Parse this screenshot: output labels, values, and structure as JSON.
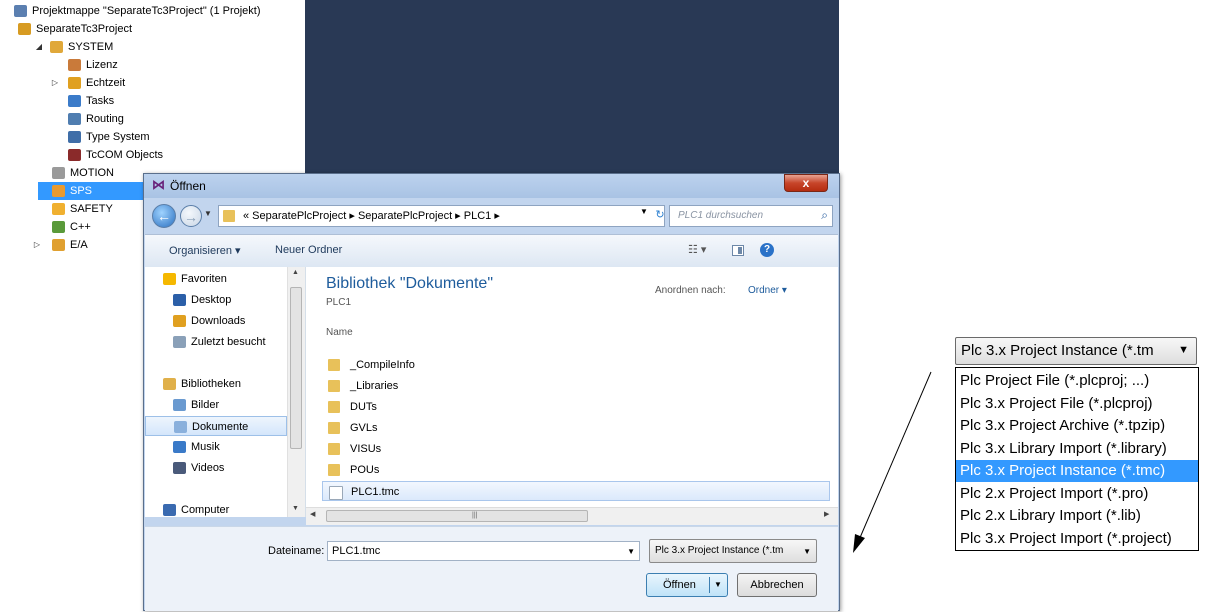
{
  "solution_tree": {
    "items": [
      {
        "label": "Projektmappe \"SeparateTc3Project\" (1 Projekt)",
        "icon": "solution-icon",
        "expander": "",
        "color": "#5b7fb0"
      },
      {
        "label": "SeparateTc3Project",
        "icon": "project-icon",
        "expander": "◢",
        "color": "#d79b22"
      },
      {
        "label": "SYSTEM",
        "icon": "system-icon",
        "expander": "◢",
        "color": "#e0a83a"
      },
      {
        "label": "Lizenz",
        "icon": "license-icon",
        "expander": "",
        "color": "#c97a3a"
      },
      {
        "label": "Echtzeit",
        "icon": "realtime-icon",
        "expander": "▷",
        "color": "#e0a020"
      },
      {
        "label": "Tasks",
        "icon": "tasks-icon",
        "expander": "",
        "color": "#3b7bc9"
      },
      {
        "label": "Routing",
        "icon": "routing-icon",
        "expander": "",
        "color": "#4f7db0"
      },
      {
        "label": "Type System",
        "icon": "type-system-icon",
        "expander": "",
        "color": "#3f6ea8"
      },
      {
        "label": "TcCOM Objects",
        "icon": "tccom-icon",
        "expander": "",
        "color": "#8a2a2a"
      },
      {
        "label": "MOTION",
        "icon": "motion-icon",
        "expander": "",
        "color": "#9a9a9a"
      },
      {
        "label": "SPS",
        "icon": "plc-icon",
        "expander": "",
        "color": "#e89a30"
      },
      {
        "label": "SAFETY",
        "icon": "safety-icon",
        "expander": "",
        "color": "#f0b030"
      },
      {
        "label": "C++",
        "icon": "cpp-icon",
        "expander": "",
        "color": "#5a9a3a"
      },
      {
        "label": "E/A",
        "icon": "io-icon",
        "expander": "▷",
        "color": "#e0a030"
      }
    ]
  },
  "dialog": {
    "title": "Öffnen",
    "close": "x",
    "address_path": "« SeparatePlcProject ▸ SeparatePlcProject ▸ PLC1 ▸",
    "search_placeholder": "PLC1 durchsuchen",
    "toolbar": {
      "organize": "Organisieren ▾",
      "new_folder": "Neuer Ordner",
      "views": "☷ ▾",
      "help": "?"
    },
    "nav": [
      {
        "label": "Favoriten",
        "icon": "star-icon",
        "indent": 0,
        "color": "#f5b800"
      },
      {
        "label": "Desktop",
        "icon": "desktop-icon",
        "indent": 1,
        "color": "#2b5fa8"
      },
      {
        "label": "Downloads",
        "icon": "downloads-icon",
        "indent": 1,
        "color": "#e0a020"
      },
      {
        "label": "Zuletzt besucht",
        "icon": "recent-icon",
        "indent": 1,
        "color": "#8aa0b8"
      },
      {
        "label": "",
        "icon": "",
        "indent": 0,
        "color": ""
      },
      {
        "label": "Bibliotheken",
        "icon": "library-icon",
        "indent": 0,
        "color": "#e0b04a"
      },
      {
        "label": "Bilder",
        "icon": "pictures-icon",
        "indent": 1,
        "color": "#6a9ad0"
      },
      {
        "label": "Dokumente",
        "icon": "documents-icon",
        "indent": 1,
        "color": "#8ab0dc"
      },
      {
        "label": "Musik",
        "icon": "music-icon",
        "indent": 1,
        "color": "#3a7ac8"
      },
      {
        "label": "Videos",
        "icon": "videos-icon",
        "indent": 1,
        "color": "#4a5a7a"
      },
      {
        "label": "",
        "icon": "",
        "indent": 0,
        "color": ""
      },
      {
        "label": "Computer",
        "icon": "computer-icon",
        "indent": 0,
        "color": "#3a6ab0"
      }
    ],
    "library_title": "Bibliothek \"Dokumente\"",
    "library_sub": "PLC1",
    "arrange_label": "Anordnen nach:",
    "arrange_value": "Ordner ▾",
    "column_name": "Name",
    "files": [
      {
        "name": "_CompileInfo",
        "type": "folder"
      },
      {
        "name": "_Libraries",
        "type": "folder"
      },
      {
        "name": "DUTs",
        "type": "folder"
      },
      {
        "name": "GVLs",
        "type": "folder"
      },
      {
        "name": "VISUs",
        "type": "folder"
      },
      {
        "name": "POUs",
        "type": "folder"
      },
      {
        "name": "PLC1.tmc",
        "type": "file"
      }
    ],
    "filename_label": "Dateiname:",
    "filename_value": "PLC1.tmc",
    "filetype_value": "Plc 3.x Project Instance (*.tm",
    "open_label": "Öffnen",
    "cancel_label": "Abbrechen"
  },
  "zoom_dropdown": {
    "selected": "Plc 3.x Project Instance (*.tm",
    "options": [
      "Plc Project File (*.plcproj; ...)",
      "Plc 3.x Project File (*.plcproj)",
      "Plc 3.x Project Archive (*.tpzip)",
      "Plc 3.x Library Import (*.library)",
      "Plc 3.x Project Instance (*.tmc)",
      "Plc 2.x Project Import (*.pro)",
      "Plc 2.x Library Import (*.lib)",
      "Plc 3.x Project Import (*.project)"
    ],
    "highlighted_index": 4
  },
  "colors": {
    "selection": "#3399ff",
    "dark_pane": "#293955",
    "dialog_frame": "#c2d5ee"
  }
}
